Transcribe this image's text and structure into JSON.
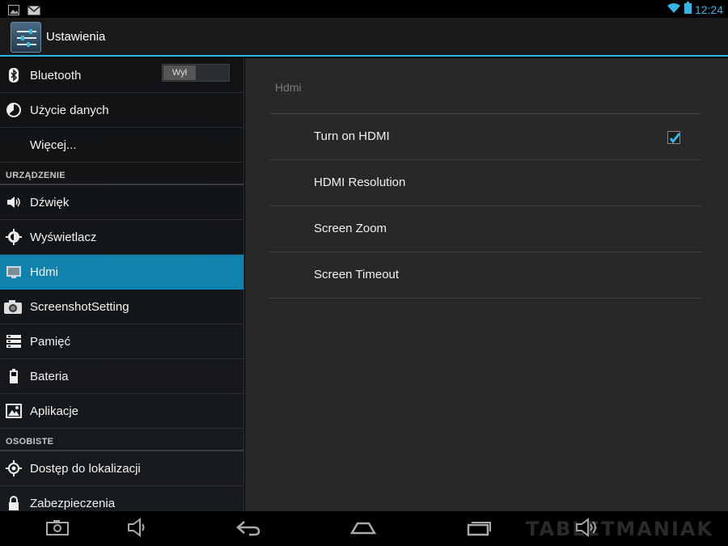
{
  "status_bar": {
    "clock": "12:24",
    "left_icons": [
      "gallery-notification-icon",
      "gmail-notification-icon"
    ],
    "right_icons": [
      "wifi-icon",
      "battery-icon"
    ],
    "accent": "#33b5e5"
  },
  "action_bar": {
    "title": "Ustawienia",
    "icon": "settings-sliders-icon"
  },
  "left_list": {
    "items_top": [
      {
        "label": "Bluetooth",
        "icon": "bluetooth-icon",
        "toggle": "Wył"
      },
      {
        "label": "Użycie danych",
        "icon": "data-usage-icon"
      },
      {
        "label": "Więcej...",
        "icon": ""
      }
    ],
    "section_device": "URZĄDZENIE",
    "items_device": [
      {
        "label": "Dźwięk",
        "icon": "sound-icon"
      },
      {
        "label": "Wyświetlacz",
        "icon": "display-icon"
      },
      {
        "label": "Hdmi",
        "icon": "hdmi-icon",
        "selected": true
      },
      {
        "label": "ScreenshotSetting",
        "icon": "camera-icon"
      },
      {
        "label": "Pamięć",
        "icon": "storage-icon"
      },
      {
        "label": "Bateria",
        "icon": "battery-setting-icon"
      },
      {
        "label": "Aplikacje",
        "icon": "apps-icon"
      }
    ],
    "section_personal": "OSOBISTE",
    "items_personal": [
      {
        "label": "Dostęp do lokalizacji",
        "icon": "location-icon"
      },
      {
        "label": "Zabezpieczenia",
        "icon": "lock-icon"
      }
    ],
    "selected_color": "#0f82ad"
  },
  "right_panel": {
    "title": "Hdmi",
    "prefs": [
      {
        "label": "Turn on HDMI",
        "checked": true
      },
      {
        "label": "HDMI Resolution"
      },
      {
        "label": "Screen Zoom"
      },
      {
        "label": "Screen Timeout"
      }
    ]
  },
  "watermark": "TABLETMANIAK",
  "nav_bar": {
    "buttons": [
      "screenshot-icon",
      "volume-down-icon",
      "back-icon",
      "home-icon",
      "recent-apps-icon",
      "volume-up-icon"
    ]
  }
}
